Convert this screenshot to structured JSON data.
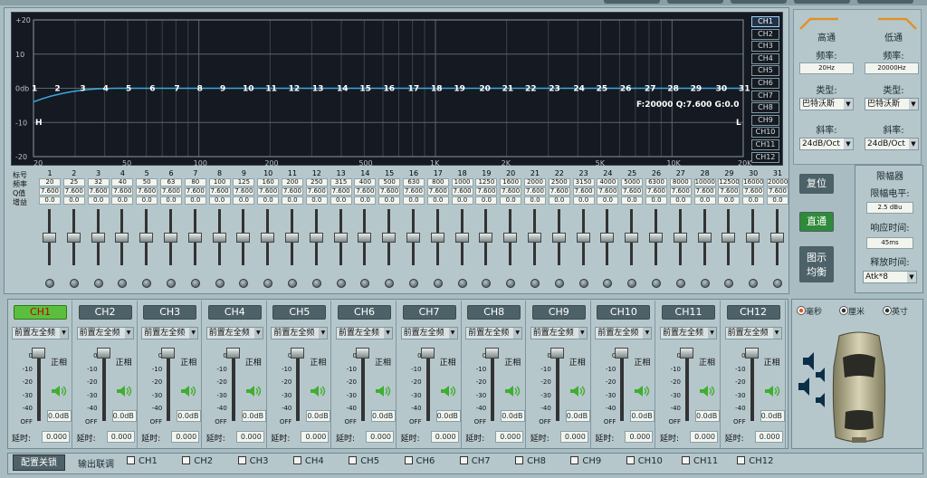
{
  "graph": {
    "y_labels": [
      "+20",
      "10",
      "0db",
      "-10",
      "-20"
    ],
    "x_labels": [
      "20",
      "50",
      "100",
      "200",
      "500",
      "1K",
      "2K",
      "5K",
      "10K",
      "20K"
    ],
    "band_numbers": [
      "1",
      "2",
      "3",
      "4",
      "5",
      "6",
      "7",
      "8",
      "9",
      "10",
      "11",
      "12",
      "13",
      "14",
      "15",
      "16",
      "17",
      "18",
      "19",
      "20",
      "21",
      "22",
      "23",
      "24",
      "25",
      "26",
      "27",
      "28",
      "29",
      "30",
      "31"
    ],
    "readout": "F:20000 Q:7.600 G:0.0",
    "marker_high": "H",
    "marker_low": "L",
    "curve_color": "#39a9e0"
  },
  "channel_selector": [
    "CH1",
    "CH2",
    "CH3",
    "CH4",
    "CH5",
    "CH6",
    "CH7",
    "CH8",
    "CH9",
    "CH10",
    "CH11",
    "CH12"
  ],
  "eq": {
    "row_labels": [
      "标号",
      "频率",
      "Q值",
      "增益"
    ],
    "bands": [
      {
        "n": "1",
        "f": "20",
        "q": "7.600",
        "g": "0.0"
      },
      {
        "n": "2",
        "f": "25",
        "q": "7.600",
        "g": "0.0"
      },
      {
        "n": "3",
        "f": "32",
        "q": "7.600",
        "g": "0.0"
      },
      {
        "n": "4",
        "f": "40",
        "q": "7.600",
        "g": "0.0"
      },
      {
        "n": "5",
        "f": "50",
        "q": "7.600",
        "g": "0.0"
      },
      {
        "n": "6",
        "f": "63",
        "q": "7.600",
        "g": "0.0"
      },
      {
        "n": "7",
        "f": "80",
        "q": "7.600",
        "g": "0.0"
      },
      {
        "n": "8",
        "f": "100",
        "q": "7.600",
        "g": "0.0"
      },
      {
        "n": "9",
        "f": "125",
        "q": "7.600",
        "g": "0.0"
      },
      {
        "n": "10",
        "f": "160",
        "q": "7.600",
        "g": "0.0"
      },
      {
        "n": "11",
        "f": "200",
        "q": "7.600",
        "g": "0.0"
      },
      {
        "n": "12",
        "f": "250",
        "q": "7.600",
        "g": "0.0"
      },
      {
        "n": "13",
        "f": "315",
        "q": "7.600",
        "g": "0.0"
      },
      {
        "n": "14",
        "f": "400",
        "q": "7.600",
        "g": "0.0"
      },
      {
        "n": "15",
        "f": "500",
        "q": "7.600",
        "g": "0.0"
      },
      {
        "n": "16",
        "f": "630",
        "q": "7.600",
        "g": "0.0"
      },
      {
        "n": "17",
        "f": "800",
        "q": "7.600",
        "g": "0.0"
      },
      {
        "n": "18",
        "f": "1000",
        "q": "7.600",
        "g": "0.0"
      },
      {
        "n": "19",
        "f": "1250",
        "q": "7.600",
        "g": "0.0"
      },
      {
        "n": "20",
        "f": "1600",
        "q": "7.600",
        "g": "0.0"
      },
      {
        "n": "21",
        "f": "2000",
        "q": "7.600",
        "g": "0.0"
      },
      {
        "n": "22",
        "f": "2500",
        "q": "7.600",
        "g": "0.0"
      },
      {
        "n": "23",
        "f": "3150",
        "q": "7.600",
        "g": "0.0"
      },
      {
        "n": "24",
        "f": "4000",
        "q": "7.600",
        "g": "0.0"
      },
      {
        "n": "25",
        "f": "5000",
        "q": "7.600",
        "g": "0.0"
      },
      {
        "n": "26",
        "f": "6300",
        "q": "7.600",
        "g": "0.0"
      },
      {
        "n": "27",
        "f": "8000",
        "q": "7.600",
        "g": "0.0"
      },
      {
        "n": "28",
        "f": "10000",
        "q": "7.600",
        "g": "0.0"
      },
      {
        "n": "29",
        "f": "12500",
        "q": "7.600",
        "g": "0.0"
      },
      {
        "n": "30",
        "f": "16000",
        "q": "7.600",
        "g": "0.0"
      },
      {
        "n": "31",
        "f": "20000",
        "q": "7.600",
        "g": "0.0"
      }
    ]
  },
  "crossover": {
    "high_title": "高通",
    "low_title": "低通",
    "freq_label": "频率:",
    "high_freq": "20Hz",
    "low_freq": "20000Hz",
    "type_label": "类型:",
    "high_type": "巴特沃斯",
    "low_type": "巴特沃斯",
    "slope_label": "斜率:",
    "high_slope": "24dB/Oct",
    "low_slope": "24dB/Oct"
  },
  "side_buttons": {
    "reset": "复位",
    "bypass": "直通",
    "eq_display_1": "图示",
    "eq_display_2": "均衡"
  },
  "limiter": {
    "title": "限幅器",
    "level_label": "限幅电平:",
    "level": "2.5 dBu",
    "attack_label": "响应时间:",
    "attack": "45ms",
    "release_label": "释放时间:",
    "release": "Atk*8"
  },
  "channels": [
    {
      "name": "CH1",
      "pos": "前置左全频",
      "phase": "正相",
      "gain": "0.0dB",
      "delay": "0.000"
    },
    {
      "name": "CH2",
      "pos": "前置左全频",
      "phase": "正相",
      "gain": "0.0dB",
      "delay": "0.000"
    },
    {
      "name": "CH3",
      "pos": "前置左全频",
      "phase": "正相",
      "gain": "0.0dB",
      "delay": "0.000"
    },
    {
      "name": "CH4",
      "pos": "前置左全频",
      "phase": "正相",
      "gain": "0.0dB",
      "delay": "0.000"
    },
    {
      "name": "CH5",
      "pos": "前置左全频",
      "phase": "正相",
      "gain": "0.0dB",
      "delay": "0.000"
    },
    {
      "name": "CH6",
      "pos": "前置左全频",
      "phase": "正相",
      "gain": "0.0dB",
      "delay": "0.000"
    },
    {
      "name": "CH7",
      "pos": "前置左全频",
      "phase": "正相",
      "gain": "0.0dB",
      "delay": "0.000"
    },
    {
      "name": "CH8",
      "pos": "前置左全频",
      "phase": "正相",
      "gain": "0.0dB",
      "delay": "0.000"
    },
    {
      "name": "CH9",
      "pos": "前置左全频",
      "phase": "正相",
      "gain": "0.0dB",
      "delay": "0.000"
    },
    {
      "name": "CH10",
      "pos": "前置左全频",
      "phase": "正相",
      "gain": "0.0dB",
      "delay": "0.000"
    },
    {
      "name": "CH11",
      "pos": "前置左全频",
      "phase": "正相",
      "gain": "0.0dB",
      "delay": "0.000"
    },
    {
      "name": "CH12",
      "pos": "前置左全频",
      "phase": "正相",
      "gain": "0.0dB",
      "delay": "0.000"
    }
  ],
  "channel_scale": [
    "0",
    "-10",
    "-20",
    "-30",
    "-40",
    "OFF"
  ],
  "delay_label": "延时:",
  "units": {
    "ms": "毫秒",
    "cm": "厘米",
    "inch": "英寸"
  },
  "bottom": {
    "config_lock": "配置关锁",
    "link_label": "输出联调",
    "links": [
      "CH1",
      "CH2",
      "CH3",
      "CH4",
      "CH5",
      "CH6",
      "CH7",
      "CH8",
      "CH9",
      "CH10",
      "CH11",
      "CH12"
    ]
  }
}
